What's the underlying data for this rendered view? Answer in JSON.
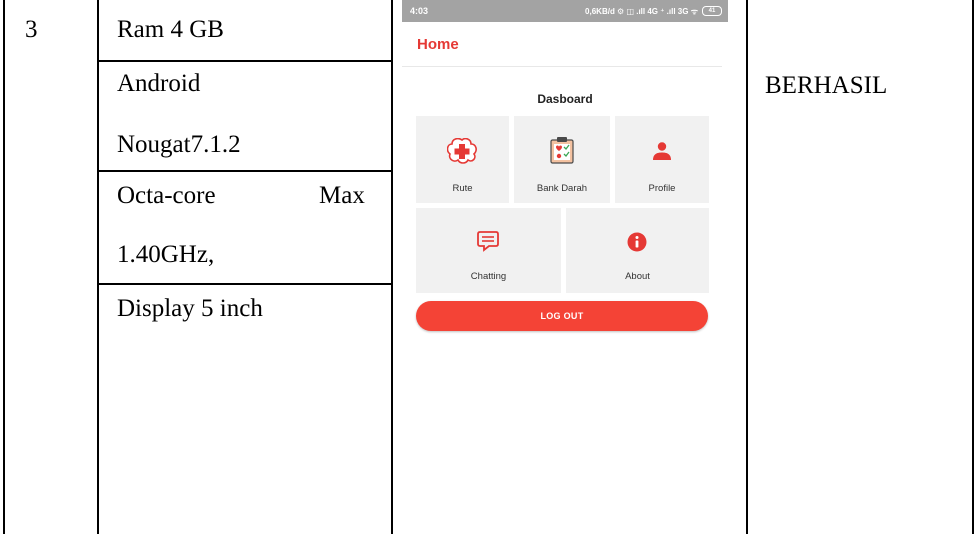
{
  "table": {
    "row_number": "3",
    "specs": [
      "Ram 4 GB",
      "Android",
      "Nougat7.1.2",
      "Octa-core",
      "Max",
      "1.40GHz,",
      "Display 5 inch"
    ],
    "result": "BERHASIL"
  },
  "phone": {
    "status_bar": {
      "time": "4:03",
      "indicators": "0,6KB/d ⚙ ◫ .ıll 4G ⁺ .ıll 3G ᯤ",
      "battery": "41"
    },
    "app_bar": {
      "title": "Home"
    },
    "dashboard": {
      "title": "Dasboard",
      "tiles": [
        {
          "label": "Rute",
          "icon": "medical-cross-icon"
        },
        {
          "label": "Bank Darah",
          "icon": "clipboard-icon"
        },
        {
          "label": "Profile",
          "icon": "person-icon"
        },
        {
          "label": "Chatting",
          "icon": "chat-icon"
        },
        {
          "label": "About",
          "icon": "info-icon"
        }
      ]
    },
    "logout_label": "LOG OUT"
  },
  "colors": {
    "accent": "#f44336",
    "tile_bg": "#f1f1f1",
    "status_bar": "#a3a3a3"
  }
}
